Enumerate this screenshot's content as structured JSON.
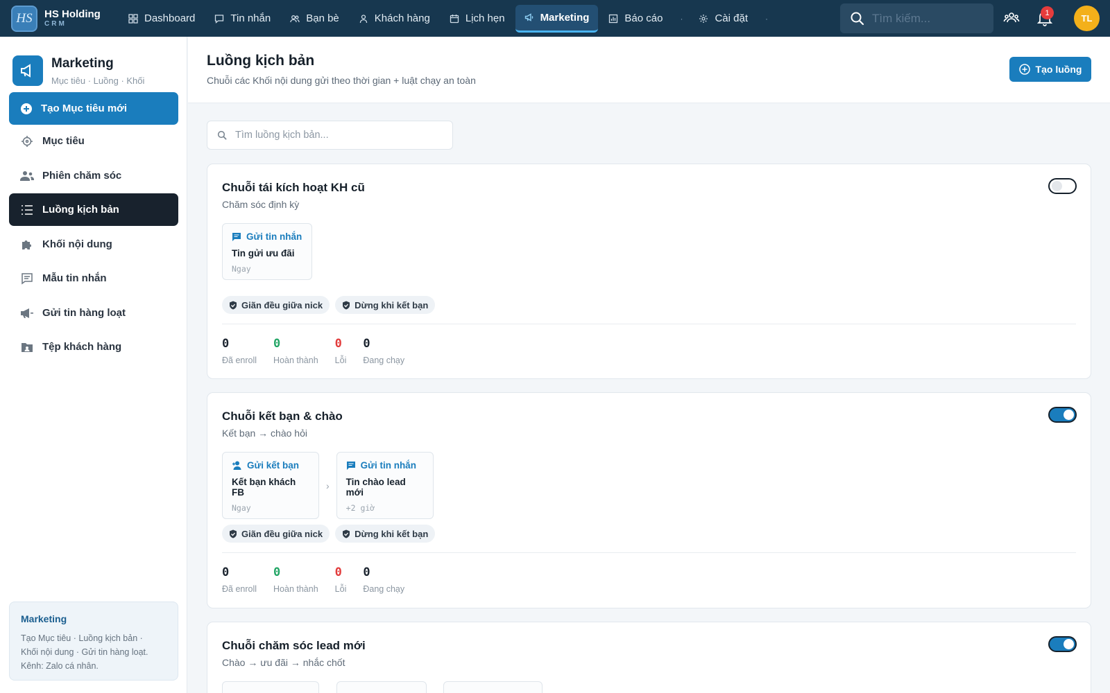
{
  "brand": {
    "logo": "HS",
    "name": "HS Holding",
    "sub": "CRM"
  },
  "nav": [
    {
      "label": "Dashboard",
      "icon": "grid-icon"
    },
    {
      "label": "Tin nhắn",
      "icon": "message-icon"
    },
    {
      "label": "Bạn bè",
      "icon": "users-icon"
    },
    {
      "label": "Khách hàng",
      "icon": "user-icon"
    },
    {
      "label": "Lịch hẹn",
      "icon": "calendar-icon"
    },
    {
      "label": "Marketing",
      "icon": "megaphone-icon",
      "active": true
    },
    {
      "label": "Báo cáo",
      "icon": "chart-icon"
    },
    {
      "label": "Cài đặt",
      "icon": "gear-icon"
    }
  ],
  "top": {
    "search_placeholder": "Tìm kiếm...",
    "notification_count": "1",
    "avatar_initials": "TL"
  },
  "sidebar": {
    "title": "Marketing",
    "subtitle": "Mục tiêu · Luồng · Khối",
    "primary_label": "Tạo Mục tiêu mới",
    "items": [
      {
        "label": "Mục tiêu",
        "icon": "target-icon"
      },
      {
        "label": "Phiên chăm sóc",
        "icon": "people-icon"
      },
      {
        "label": "Luồng kịch bản",
        "icon": "list-icon",
        "active": true
      },
      {
        "label": "Khối nội dung",
        "icon": "puzzle-icon"
      },
      {
        "label": "Mẫu tin nhắn",
        "icon": "template-icon"
      },
      {
        "label": "Gửi tin hàng loạt",
        "icon": "bullhorn-icon"
      },
      {
        "label": "Tệp khách hàng",
        "icon": "folder-icon"
      }
    ],
    "info_title": "Marketing",
    "info_text_1": "Tạo Mục tiêu · Luồng kịch bản ·",
    "info_text_2": "Khối nội dung · Gửi tin hàng loạt.",
    "info_text_3": "Kênh: Zalo cá nhân."
  },
  "main": {
    "title": "Luồng kịch bản",
    "subtitle": "Chuỗi các Khối nội dung gửi theo thời gian + luật chạy an toàn",
    "create_label": "Tạo luồng",
    "search_placeholder": "Tìm luồng kịch bản..."
  },
  "flows": [
    {
      "title": "Chuỗi tái kích hoạt KH cũ",
      "subtitle": "Chăm sóc định kỳ",
      "enabled": false,
      "steps": [
        {
          "type": "Gửi tin nhắn",
          "name": "Tin gửi ưu đãi",
          "time": "Ngay"
        }
      ],
      "tags": [
        "Giãn đều giữa nick",
        "Dừng khi kết bạn"
      ],
      "stats": [
        {
          "value": "0",
          "label": "Đã enroll",
          "color": "#15202b"
        },
        {
          "value": "0",
          "label": "Hoàn thành",
          "color": "#22a565"
        },
        {
          "value": "0",
          "label": "Lỗi",
          "color": "#e23c3c"
        },
        {
          "value": "0",
          "label": "Đang chạy",
          "color": "#15202b"
        }
      ]
    },
    {
      "title": "Chuỗi kết bạn & chào",
      "subtitle": "Kết bạn → chào hỏi",
      "enabled": true,
      "steps": [
        {
          "type": "Gửi kết bạn",
          "name": "Kết bạn khách FB",
          "time": "Ngay"
        },
        {
          "type": "Gửi tin nhắn",
          "name": "Tin chào lead mới",
          "time": "+2 giờ"
        }
      ],
      "tags": [
        "Giãn đều giữa nick",
        "Dừng khi kết bạn"
      ],
      "stats": [
        {
          "value": "0",
          "label": "Đã enroll",
          "color": "#15202b"
        },
        {
          "value": "0",
          "label": "Hoàn thành",
          "color": "#22a565"
        },
        {
          "value": "0",
          "label": "Lỗi",
          "color": "#e23c3c"
        },
        {
          "value": "0",
          "label": "Đang chạy",
          "color": "#15202b"
        }
      ]
    },
    {
      "title": "Chuỗi chăm sóc lead mới",
      "subtitle": "Chào → ưu đãi → nhắc chốt",
      "enabled": true
    }
  ],
  "colors": {
    "accent": "#1a7dbd",
    "nav_bg": "#17374f",
    "active_dark": "#18222d",
    "success": "#22a565",
    "error": "#e23c3c"
  }
}
